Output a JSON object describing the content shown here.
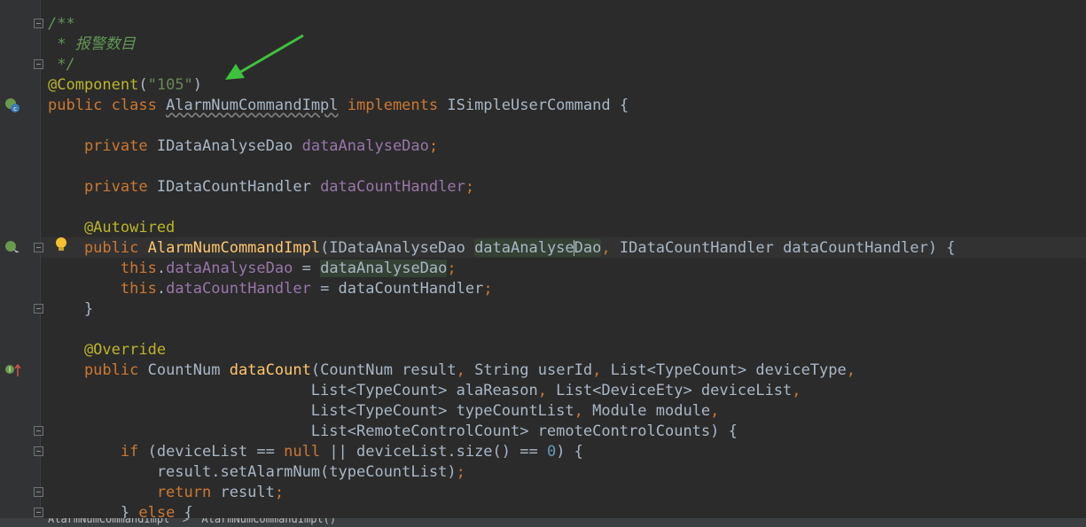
{
  "editor": {
    "lines": [
      {
        "tokens": [
          {
            "c": "doc",
            "t": "/**"
          }
        ]
      },
      {
        "tokens": [
          {
            "c": "doc",
            "t": " * 报警数目"
          }
        ]
      },
      {
        "tokens": [
          {
            "c": "doc",
            "t": " */"
          }
        ]
      },
      {
        "tokens": [
          {
            "c": "ann",
            "t": "@Component"
          },
          {
            "c": "",
            "t": "("
          },
          {
            "c": "str",
            "t": "\"105\""
          },
          {
            "c": "",
            "t": ")"
          }
        ]
      },
      {
        "tokens": [
          {
            "c": "kw",
            "t": "public class "
          },
          {
            "c": "squig",
            "t": "AlarmNumCommandImpl"
          },
          {
            "c": "kw",
            "t": " implements "
          },
          {
            "c": "",
            "t": "ISimpleUserCommand {"
          }
        ]
      },
      {
        "tokens": []
      },
      {
        "tokens": [
          {
            "c": "kw",
            "t": "    private "
          },
          {
            "c": "",
            "t": "IDataAnalyseDao "
          },
          {
            "c": "fld",
            "t": "dataAnalyseDao"
          },
          {
            "c": "kw",
            "t": ";"
          }
        ]
      },
      {
        "tokens": []
      },
      {
        "tokens": [
          {
            "c": "kw",
            "t": "    private "
          },
          {
            "c": "",
            "t": "IDataCountHandler "
          },
          {
            "c": "fld",
            "t": "dataCountHandler"
          },
          {
            "c": "kw",
            "t": ";"
          }
        ]
      },
      {
        "tokens": []
      },
      {
        "tokens": [
          {
            "c": "ann",
            "t": "    @Autowired"
          }
        ]
      },
      {
        "tokens": [
          {
            "c": "kw",
            "t": "    public "
          },
          {
            "c": "mth",
            "t": "AlarmNumCommandImpl"
          },
          {
            "c": "",
            "t": "(IDataAnalyseDao "
          },
          {
            "c": "hl",
            "t": "dataAnalyse"
          },
          {
            "c": "caret",
            "t": ""
          },
          {
            "c": "hl",
            "t": "Dao"
          },
          {
            "c": "kw",
            "t": ", "
          },
          {
            "c": "",
            "t": "IDataCountHandler dataCountHandler) {"
          }
        ]
      },
      {
        "tokens": [
          {
            "c": "kw",
            "t": "        this"
          },
          {
            "c": "",
            "t": "."
          },
          {
            "c": "fld",
            "t": "dataAnalyseDao"
          },
          {
            "c": "",
            "t": " = "
          },
          {
            "c": "hl",
            "t": "dataAnalyseDao"
          },
          {
            "c": "kw",
            "t": ";"
          }
        ]
      },
      {
        "tokens": [
          {
            "c": "kw",
            "t": "        this"
          },
          {
            "c": "",
            "t": "."
          },
          {
            "c": "fld",
            "t": "dataCountHandler"
          },
          {
            "c": "",
            "t": " = dataCountHandler"
          },
          {
            "c": "kw",
            "t": ";"
          }
        ]
      },
      {
        "tokens": [
          {
            "c": "",
            "t": "    }"
          }
        ]
      },
      {
        "tokens": []
      },
      {
        "tokens": [
          {
            "c": "ann",
            "t": "    @Override"
          }
        ]
      },
      {
        "tokens": [
          {
            "c": "kw",
            "t": "    public "
          },
          {
            "c": "",
            "t": "CountNum "
          },
          {
            "c": "mth",
            "t": "dataCount"
          },
          {
            "c": "",
            "t": "(CountNum result"
          },
          {
            "c": "kw",
            "t": ", "
          },
          {
            "c": "",
            "t": "String userId"
          },
          {
            "c": "kw",
            "t": ", "
          },
          {
            "c": "",
            "t": "List<TypeCount> deviceType"
          },
          {
            "c": "kw",
            "t": ","
          }
        ]
      },
      {
        "tokens": [
          {
            "c": "",
            "t": "                             List<TypeCount> alaReason"
          },
          {
            "c": "kw",
            "t": ", "
          },
          {
            "c": "",
            "t": "List<DeviceEty> deviceList"
          },
          {
            "c": "kw",
            "t": ","
          }
        ]
      },
      {
        "tokens": [
          {
            "c": "",
            "t": "                             List<TypeCount> typeCountList"
          },
          {
            "c": "kw",
            "t": ", "
          },
          {
            "c": "",
            "t": "Module module"
          },
          {
            "c": "kw",
            "t": ","
          }
        ]
      },
      {
        "tokens": [
          {
            "c": "",
            "t": "                             List<RemoteControlCount> remoteControlCounts) {"
          }
        ]
      },
      {
        "tokens": [
          {
            "c": "kw",
            "t": "        if "
          },
          {
            "c": "",
            "t": "(deviceList == "
          },
          {
            "c": "kw",
            "t": "null "
          },
          {
            "c": "",
            "t": "|| deviceList.size() == "
          },
          {
            "c": "num",
            "t": "0"
          },
          {
            "c": "",
            "t": ") {"
          }
        ]
      },
      {
        "tokens": [
          {
            "c": "",
            "t": "            result.setAlarmNum(typeCountList)"
          },
          {
            "c": "kw",
            "t": ";"
          }
        ]
      },
      {
        "tokens": [
          {
            "c": "kw",
            "t": "            return "
          },
          {
            "c": "",
            "t": "result"
          },
          {
            "c": "kw",
            "t": ";"
          }
        ]
      },
      {
        "tokens": [
          {
            "c": "",
            "t": "        } "
          },
          {
            "c": "kw",
            "t": "else "
          },
          {
            "c": "",
            "t": "{"
          }
        ]
      }
    ]
  },
  "status_bar": {
    "text": "AlarmNumCommandImpl  >  AlarmNumCommandImpl()"
  },
  "colors": {
    "background": "#2b2b2b",
    "keyword": "#cc7832",
    "annotation": "#bbb529",
    "string": "#6a8759",
    "field": "#9876aa",
    "method": "#ffc66d",
    "arrow": "#3ec23e"
  },
  "gutter_icons": [
    "spring-bean-icon",
    "spring-bean-navigate-icon",
    "intention-bulb-icon",
    "override-method-icon"
  ]
}
